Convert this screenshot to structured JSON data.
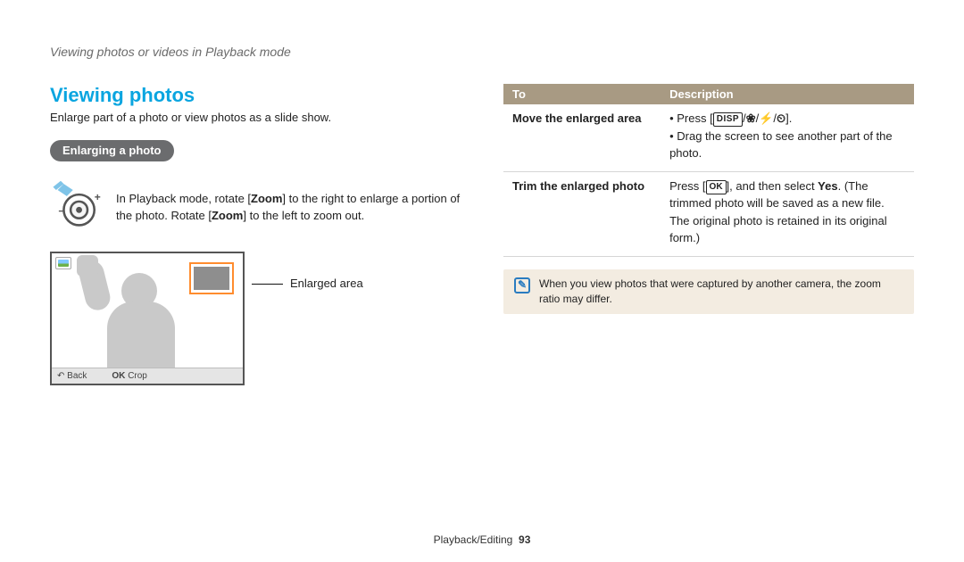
{
  "breadcrumb": "Viewing photos or videos in Playback mode",
  "left": {
    "title": "Viewing photos",
    "subtitle": "Enlarge part of a photo or view photos as a slide show.",
    "pill": "Enlarging a photo",
    "zoom_instruction_pre": "In Playback mode, rotate [",
    "zoom_word": "Zoom",
    "zoom_instruction_mid": "] to the right to enlarge a portion of the photo. Rotate [",
    "zoom_instruction_post": "] to the left to zoom out.",
    "caption": "Enlarged area",
    "scr_back_icon": "↶",
    "scr_back_label": "Back",
    "scr_ok_label": "OK",
    "scr_crop_label": "Crop"
  },
  "table": {
    "col_to": "To",
    "col_desc": "Description",
    "row1_label": "Move the enlarged area",
    "row1_b1_pre": "Press [",
    "row1_b1_post": "].",
    "row1_b2": "Drag the screen to see another part of the photo.",
    "row2_label": "Trim the enlarged photo",
    "row2_pre": "Press [",
    "row2_mid": "], and then select ",
    "row2_yes": "Yes",
    "row2_post": ". (The trimmed photo will be saved as a new file. The original photo is retained in its original form.)"
  },
  "note": "When you view photos that were captured by another camera, the zoom ratio may differ.",
  "footer_section": "Playback/Editing",
  "footer_page": "93",
  "symbols": {
    "disp": "DISP",
    "macro": "❀",
    "flash": "⚡",
    "timer": "⏲",
    "ok": "OK"
  }
}
